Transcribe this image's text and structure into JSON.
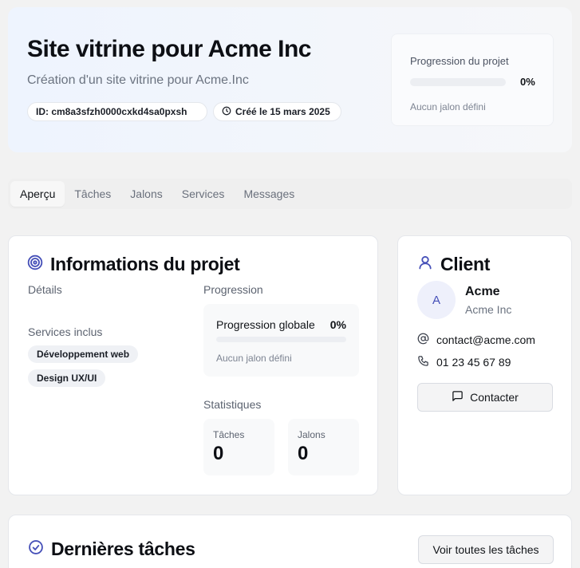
{
  "project": {
    "title": "Site vitrine pour Acme Inc",
    "subtitle": "Création d'un site vitrine pour Acme.Inc",
    "id_chip": "ID: cm8a3sfzh0000cxkd4sa0pxsh",
    "created_chip": "Créé le 15 mars 2025"
  },
  "progress_card": {
    "label": "Progression du projet",
    "percent_text": "0%",
    "progress_fraction": 0,
    "note": "Aucun jalon défini"
  },
  "tabs": [
    {
      "label": "Aperçu",
      "active": true
    },
    {
      "label": "Tâches",
      "active": false
    },
    {
      "label": "Jalons",
      "active": false
    },
    {
      "label": "Services",
      "active": false
    },
    {
      "label": "Messages",
      "active": false
    }
  ],
  "info": {
    "title": "Informations du projet",
    "details_label": "Détails",
    "services_label": "Services inclus",
    "services": [
      "Développement web",
      "Design UX/UI"
    ],
    "progress_label": "Progression",
    "global_label": "Progression globale",
    "global_percent": "0%",
    "global_fraction": 0,
    "global_note": "Aucun jalon défini",
    "stats_label": "Statistiques",
    "stats": [
      {
        "label": "Tâches",
        "value": "0"
      },
      {
        "label": "Jalons",
        "value": "0"
      }
    ]
  },
  "client": {
    "title": "Client",
    "initial": "A",
    "name": "Acme",
    "company": "Acme Inc",
    "email": "contact@acme.com",
    "phone": "01 23 45 67 89",
    "contact_button": "Contacter"
  },
  "tasks": {
    "title": "Dernières tâches",
    "view_all_button": "Voir toutes les tâches"
  },
  "colors": {
    "accent": "#2a6af6",
    "icon_indigo": "#4650b8"
  }
}
